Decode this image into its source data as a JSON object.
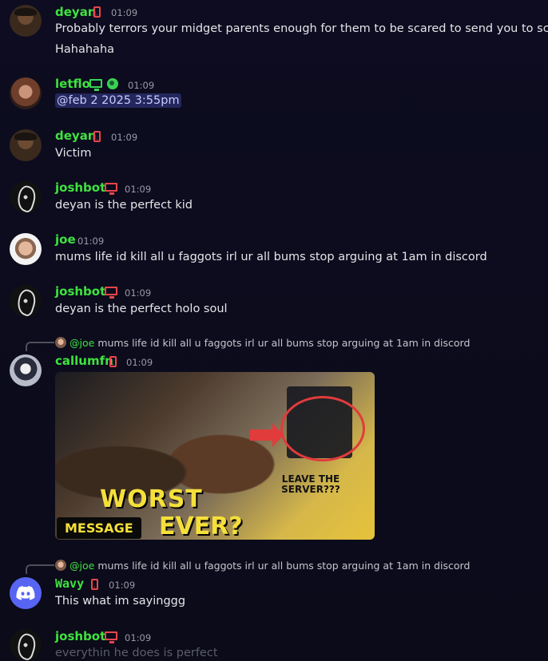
{
  "messages": [
    {
      "user": "deyan",
      "time": "01:09",
      "lines": [
        "Probably terrors your midget parents enough for them to be scared to send you to school",
        "Hahahaha"
      ]
    },
    {
      "user": "letflo",
      "time": "01:09",
      "text": "@feb 2 2025 3:55pm"
    },
    {
      "user": "deyan",
      "time": "01:09",
      "text": "Victim"
    },
    {
      "user": "joshbot",
      "time": "01:09",
      "text": "deyan is the perfect kid"
    },
    {
      "user": "joe",
      "time": "01:09",
      "text": "mums life id kill all u faggots irl ur all bums stop arguing at 1am in discord"
    },
    {
      "user": "joshbot",
      "time": "01:09",
      "text": "deyan is the perfect holo soul"
    },
    {
      "user": "callumfn",
      "time": "01:09",
      "reply": {
        "mention": "@joe",
        "text": "mums life id kill all u faggots irl ur all bums stop arguing at 1am in discord"
      },
      "embed": {
        "line1": "WORST",
        "box": "MESSAGE",
        "line2": "EVER?",
        "side": "LEAVE THE SERVER???"
      }
    },
    {
      "user": "Wavy",
      "time": "01:09",
      "reply": {
        "mention": "@joe",
        "text": "mums life id kill all u faggots irl ur all bums stop arguing at 1am in discord"
      },
      "text": "This what im sayinggg"
    },
    {
      "user": "joshbot",
      "time": "01:09",
      "text": "everythin he does is perfect"
    }
  ],
  "colors": {
    "background": "#0c0b1c",
    "username": "#3fe23f",
    "device_red": "#e8464b",
    "device_green": "#39d353",
    "mention_bg": "#3b3f7a"
  }
}
